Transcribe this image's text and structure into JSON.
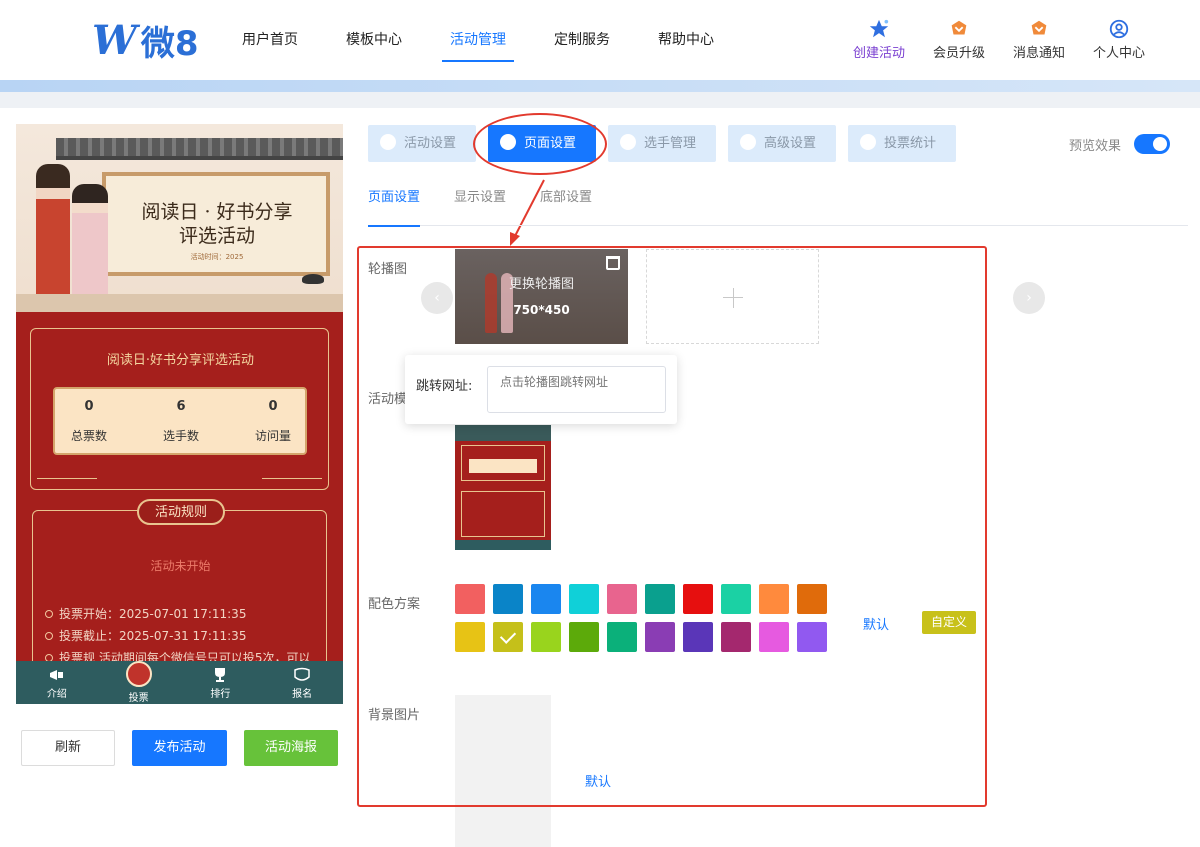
{
  "header": {
    "logo_mark": "W",
    "logo_text": "微8",
    "nav": [
      "用户首页",
      "模板中心",
      "活动管理",
      "定制服务",
      "帮助中心"
    ],
    "actions": [
      {
        "label": "创建活动",
        "icon": "star-icon"
      },
      {
        "label": "会员升级",
        "icon": "crown-icon"
      },
      {
        "label": "消息通知",
        "icon": "bell-icon"
      },
      {
        "label": "个人中心",
        "icon": "user-icon"
      }
    ]
  },
  "preview": {
    "banner_title_line1": "阅读日 · 好书分享",
    "banner_title_line2": "评选活动",
    "banner_sub": "活动时间：2025",
    "stats_title": "阅读日·好书分享评选活动",
    "stats": [
      {
        "value": "0",
        "label": "总票数"
      },
      {
        "value": "6",
        "label": "选手数"
      },
      {
        "value": "0",
        "label": "访问量"
      }
    ],
    "rules_title": "活动规则",
    "rules_status": "活动未开始",
    "rules": [
      "投票开始：2025-07-01 17:11:35",
      "投票截止：2025-07-31 17:11:35",
      "投票规      活动期间每个微信号只可以投5次，可以"
    ],
    "tabbar": [
      "介绍",
      "投票",
      "排行",
      "报名"
    ]
  },
  "buttons": {
    "refresh": "刷新",
    "publish": "发布活动",
    "poster": "活动海报"
  },
  "steps": [
    "活动设置",
    "页面设置",
    "选手管理",
    "高级设置",
    "投票统计"
  ],
  "preview_toggle_label": "预览效果",
  "subtabs": [
    "页面设置",
    "显示设置",
    "底部设置"
  ],
  "settings": {
    "carousel_label": "轮播图",
    "carousel_replace": "更换轮播图",
    "carousel_size": "750*450",
    "template_label": "活动模",
    "jump_label": "跳转网址:",
    "jump_placeholder": "点击轮播图跳转网址",
    "color_label": "配色方案",
    "color_default": "默认",
    "color_custom": "自定义",
    "bg_label": "背景图片",
    "bg_default": "默认"
  },
  "colors": {
    "accent": "#1677ff",
    "highlight": "#e23a2e",
    "swatches": [
      "#f26060",
      "#0a84c8",
      "#1a86ef",
      "#10d0d8",
      "#e8648e",
      "#0aa08e",
      "#e60f0f",
      "#1bd1a4",
      "#ff8a3d",
      "#e06b0b",
      "#e7c315",
      "#c5c01a",
      "#99d41d",
      "#5caa0a",
      "#0bb07a",
      "#8a3db4",
      "#5a36b8",
      "#a4286e",
      "#e65ae0",
      "#9159f0"
    ],
    "selected_swatch": 11
  }
}
